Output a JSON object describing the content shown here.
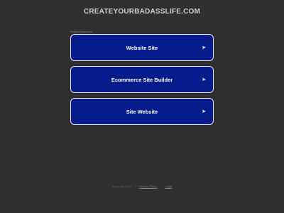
{
  "header": {
    "title": "CREATEYOURBADASSLIFE.COM"
  },
  "related": {
    "label": "Related searches",
    "items": [
      {
        "label": "Website Site",
        "arrow": "➤"
      },
      {
        "label": "Ecommerce Site Builder",
        "arrow": "➤"
      },
      {
        "label": "Site Website",
        "arrow": "➤"
      }
    ]
  },
  "footer": {
    "copyright": "Copyright 2024",
    "sep1": "|",
    "privacy": "Privacy Policy",
    "sep2": "|",
    "legal": "Legal"
  },
  "colors": {
    "background": "#2f2f2f",
    "button": "#061c8c",
    "button_border": "#e8e8e8",
    "title_text": "#cfcfcf"
  }
}
